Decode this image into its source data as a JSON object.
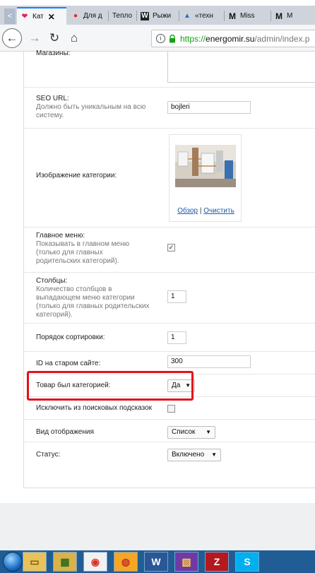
{
  "browser": {
    "tabs": [
      {
        "label": "Кат",
        "favicon": "heart-favicon",
        "active": true
      },
      {
        "label": "Для д",
        "favicon": "red-dot-favicon",
        "active": false
      },
      {
        "label": "Тепло",
        "favicon": "",
        "active": false
      },
      {
        "label": "Рыжи",
        "favicon": "W",
        "active": false
      },
      {
        "label": "«техн",
        "favicon": "flag-favicon",
        "active": false
      },
      {
        "label": "Miss",
        "favicon": "M",
        "active": false
      },
      {
        "label": "M",
        "favicon": "M",
        "active": false
      }
    ],
    "tab_scroll": "<",
    "url": {
      "scheme": "https://",
      "host": "energomir.su",
      "path": "/admin/index.p"
    }
  },
  "form": {
    "stores_label": "Магазины:",
    "seo": {
      "label": "SEO URL:",
      "help": "Должно быть уникальным на всю систему.",
      "value": "bojleri"
    },
    "image": {
      "label": "Изображение категории:",
      "browse": "Обзор",
      "separator": "|",
      "clear": "Очистить"
    },
    "main_menu": {
      "label": "Главное меню:",
      "help": "Показывать в главном меню (только для главных родительских категорий).",
      "checked": true
    },
    "columns": {
      "label": "Столбцы:",
      "help": "Количество столбцов в выпадающем меню категории (только для главных родительских категорий).",
      "value": "1"
    },
    "sort_order": {
      "label": "Порядок сортировки:",
      "value": "1"
    },
    "old_id": {
      "label": "ID на старом сайте:",
      "value": "300"
    },
    "was_category": {
      "label": "Товар был категорией:",
      "value": "Да"
    },
    "exclude_search": {
      "label": "Исключить из поисковых подсказок",
      "checked": false
    },
    "display_view": {
      "label": "Вид отображения",
      "value": "Список"
    },
    "status": {
      "label": "Статус:",
      "value": "Включено"
    }
  },
  "taskbar": {
    "apps": [
      {
        "name": "explorer-icon",
        "glyph": "▭"
      },
      {
        "name": "app-icon",
        "glyph": "▦"
      },
      {
        "name": "chrome-icon",
        "glyph": "◉"
      },
      {
        "name": "firefox-icon",
        "glyph": "◍"
      },
      {
        "name": "word-icon",
        "glyph": "W"
      },
      {
        "name": "app2-icon",
        "glyph": "▧"
      },
      {
        "name": "filezilla-icon",
        "glyph": "Z"
      },
      {
        "name": "skype-icon",
        "glyph": "S"
      }
    ]
  },
  "colors": {
    "highlight": "#e3121b",
    "link": "#1a5aa8",
    "url_secure": "#12a312",
    "taskbar": "#1f5d94"
  }
}
